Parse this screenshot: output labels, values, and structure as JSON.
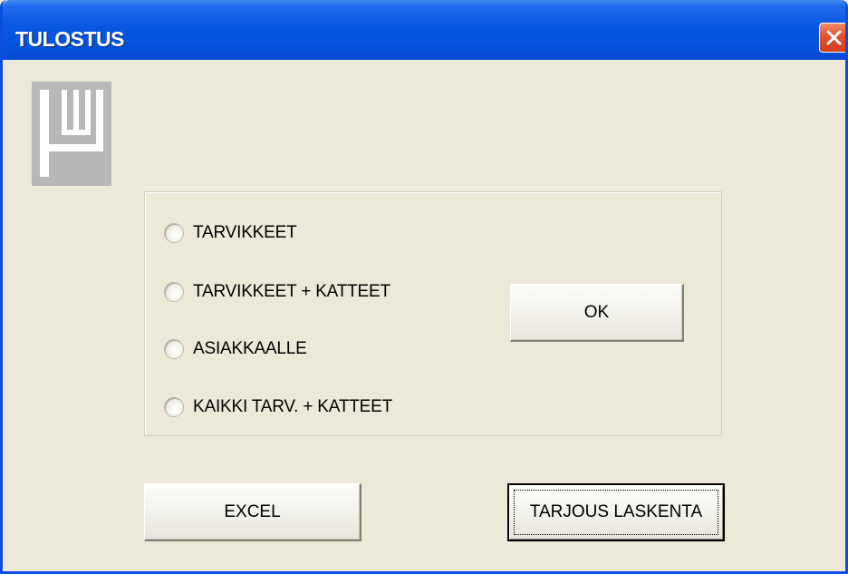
{
  "window": {
    "title": "TULOSTUS"
  },
  "icons": {
    "close": "close-icon",
    "logo": "logo-icon"
  },
  "options": {
    "items": [
      {
        "label": "TARVIKKEET",
        "selected": false
      },
      {
        "label": "TARVIKKEET + KATTEET",
        "selected": false
      },
      {
        "label": "ASIAKKAALLE",
        "selected": false
      },
      {
        "label": "KAIKKI TARV. + KATTEET",
        "selected": false
      }
    ]
  },
  "buttons": {
    "ok_label": "OK",
    "excel_label": "EXCEL",
    "tarjous_label": "TARJOUS LASKENTA"
  },
  "colors": {
    "titlebar": "#0858e2",
    "close_button": "#e5522f",
    "window_background": "#ece9d8",
    "logo": "#b8b8b8"
  }
}
